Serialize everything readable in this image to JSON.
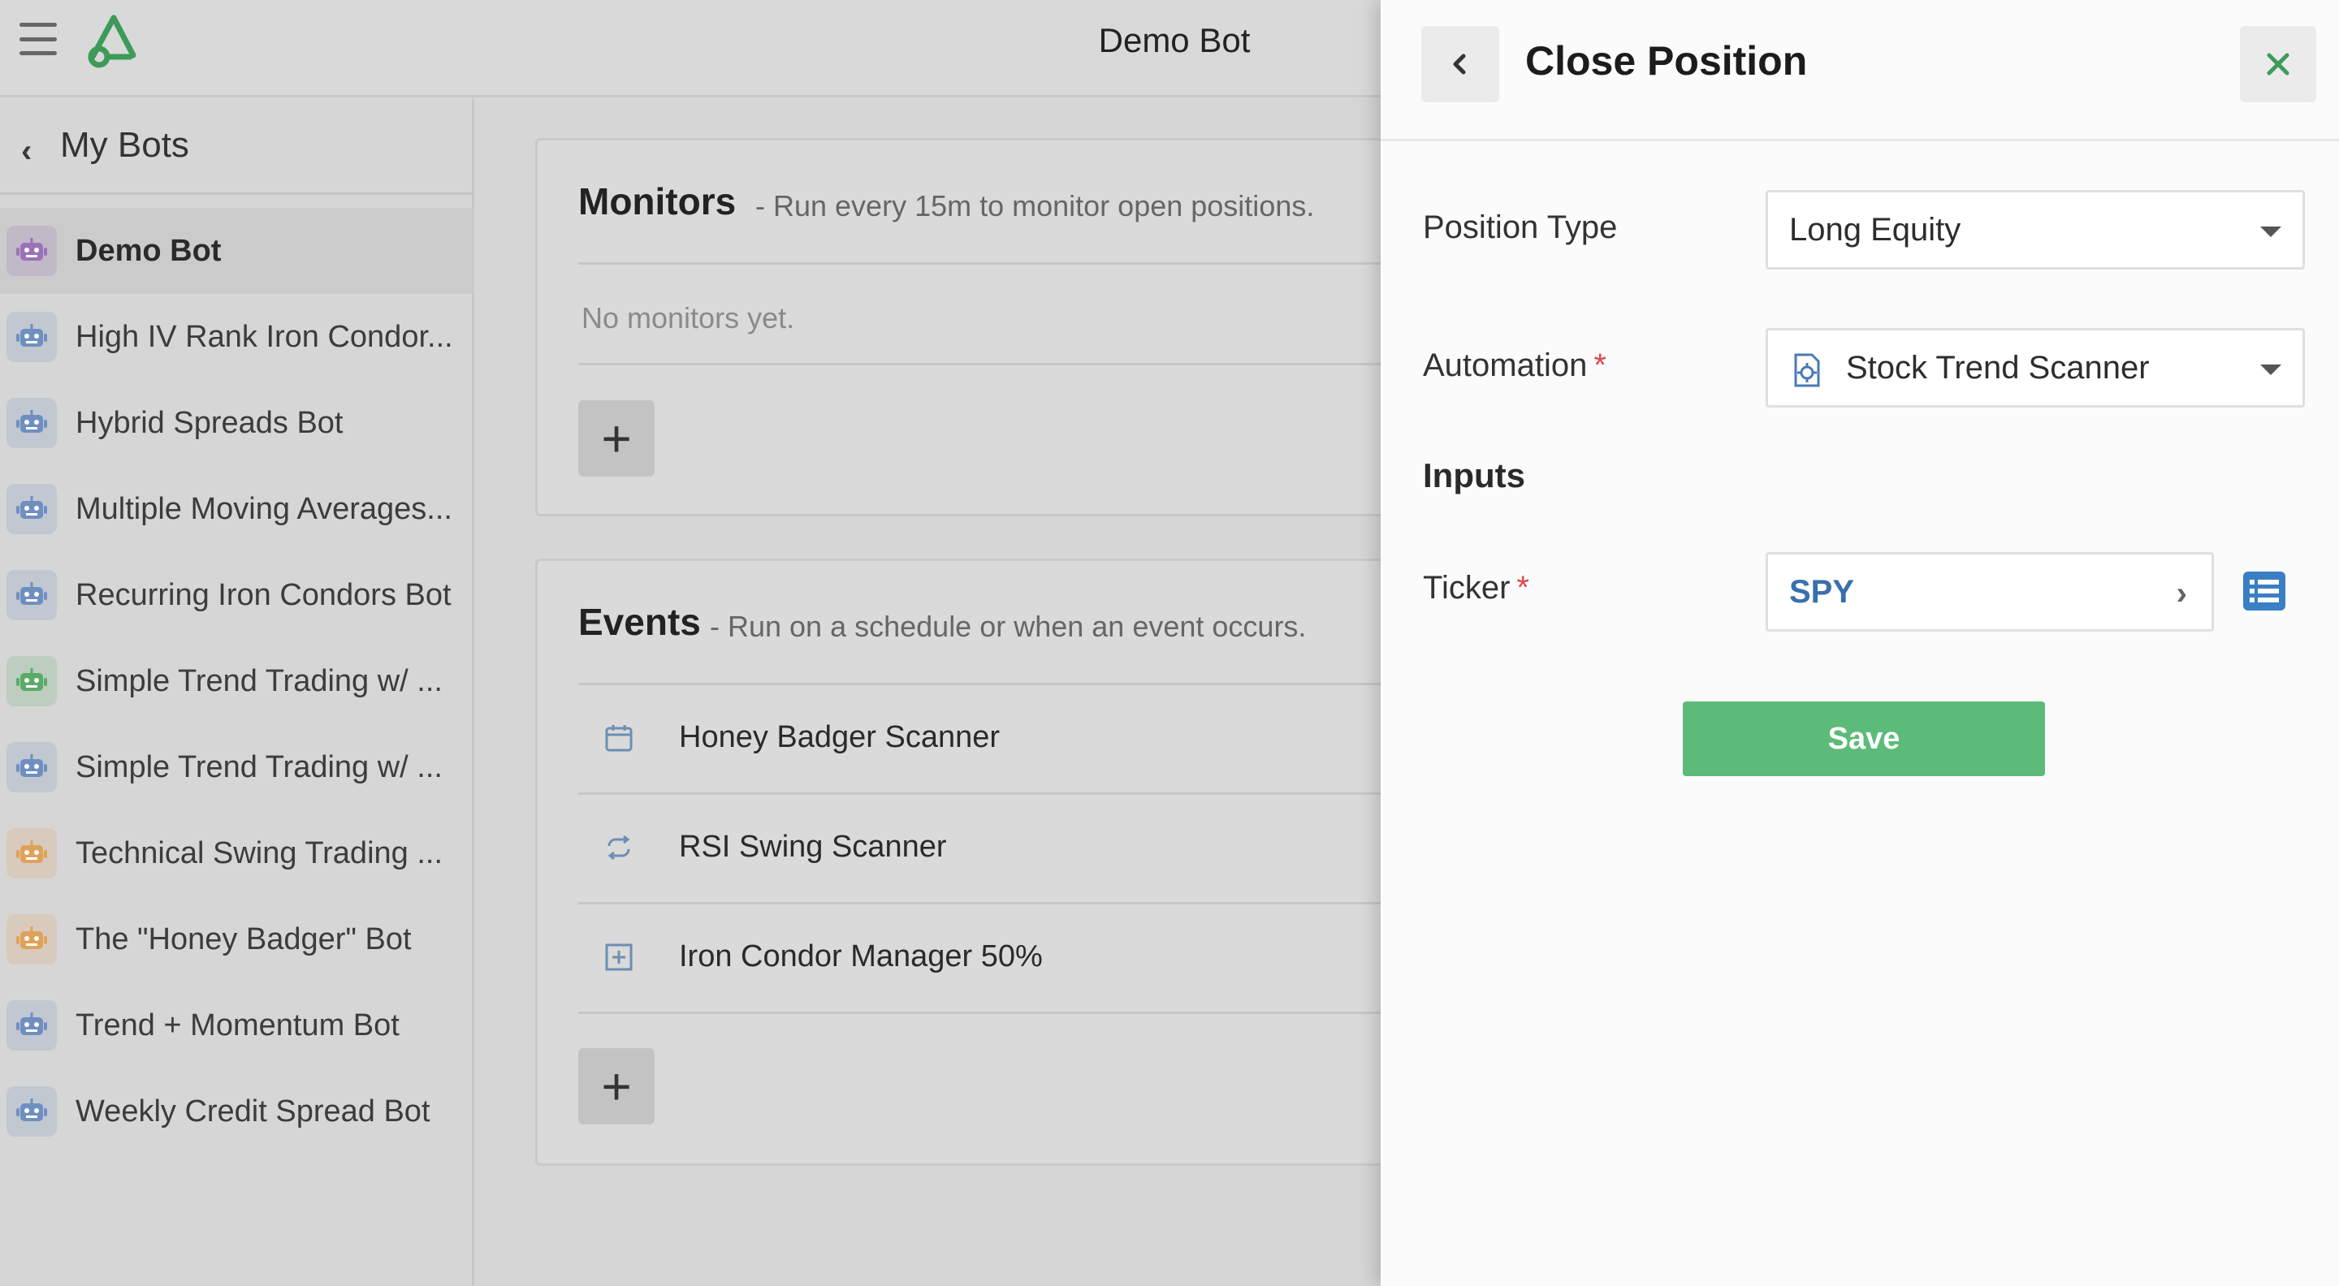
{
  "app": {
    "title": "Demo Bot"
  },
  "sidebar": {
    "back_label": "My Bots",
    "items": [
      {
        "label": "Demo Bot",
        "icon_color": "#9b72b8",
        "active": true
      },
      {
        "label": "High IV Rank Iron Condor...",
        "icon_color": "#6f8fc0"
      },
      {
        "label": "Hybrid Spreads Bot",
        "icon_color": "#6f8fc0"
      },
      {
        "label": "Multiple Moving Averages...",
        "icon_color": "#6f8fc0"
      },
      {
        "label": "Recurring Iron Condors Bot",
        "icon_color": "#6f8fc0"
      },
      {
        "label": "Simple Trend Trading w/ ...",
        "icon_color": "#5aab6a"
      },
      {
        "label": "Simple Trend Trading w/ ...",
        "icon_color": "#6f8fc0"
      },
      {
        "label": "Technical Swing Trading ...",
        "icon_color": "#e0a25a"
      },
      {
        "label": "The \"Honey Badger\" Bot",
        "icon_color": "#e0a25a"
      },
      {
        "label": "Trend + Momentum Bot",
        "icon_color": "#6f8fc0"
      },
      {
        "label": "Weekly Credit Spread Bot",
        "icon_color": "#6f8fc0"
      }
    ]
  },
  "monitors": {
    "title": "Monitors",
    "subtitle": "- Run every 15m to monitor open positions.",
    "empty_text": "No monitors yet.",
    "add_label": "+"
  },
  "events": {
    "title": "Events",
    "subtitle": "- Run on a schedule or when an event occurs.",
    "items": [
      {
        "label": "Honey Badger Scanner",
        "icon": "calendar-icon"
      },
      {
        "label": "RSI Swing Scanner",
        "icon": "repeat-icon"
      },
      {
        "label": "Iron Condor Manager 50%",
        "icon": "plus-square-icon"
      }
    ],
    "add_label": "+"
  },
  "drawer": {
    "title": "Close Position",
    "position_type": {
      "label": "Position Type",
      "value": "Long Equity"
    },
    "automation": {
      "label": "Automation",
      "required_mark": "*",
      "value": "Stock Trend Scanner"
    },
    "inputs_title": "Inputs",
    "ticker": {
      "label": "Ticker",
      "required_mark": "*",
      "value": "SPY"
    },
    "save_label": "Save"
  },
  "colors": {
    "accent_green": "#5cbb78",
    "close_icon": "#3f9a5c",
    "link_blue": "#3a6fae",
    "required": "#e0474c"
  }
}
